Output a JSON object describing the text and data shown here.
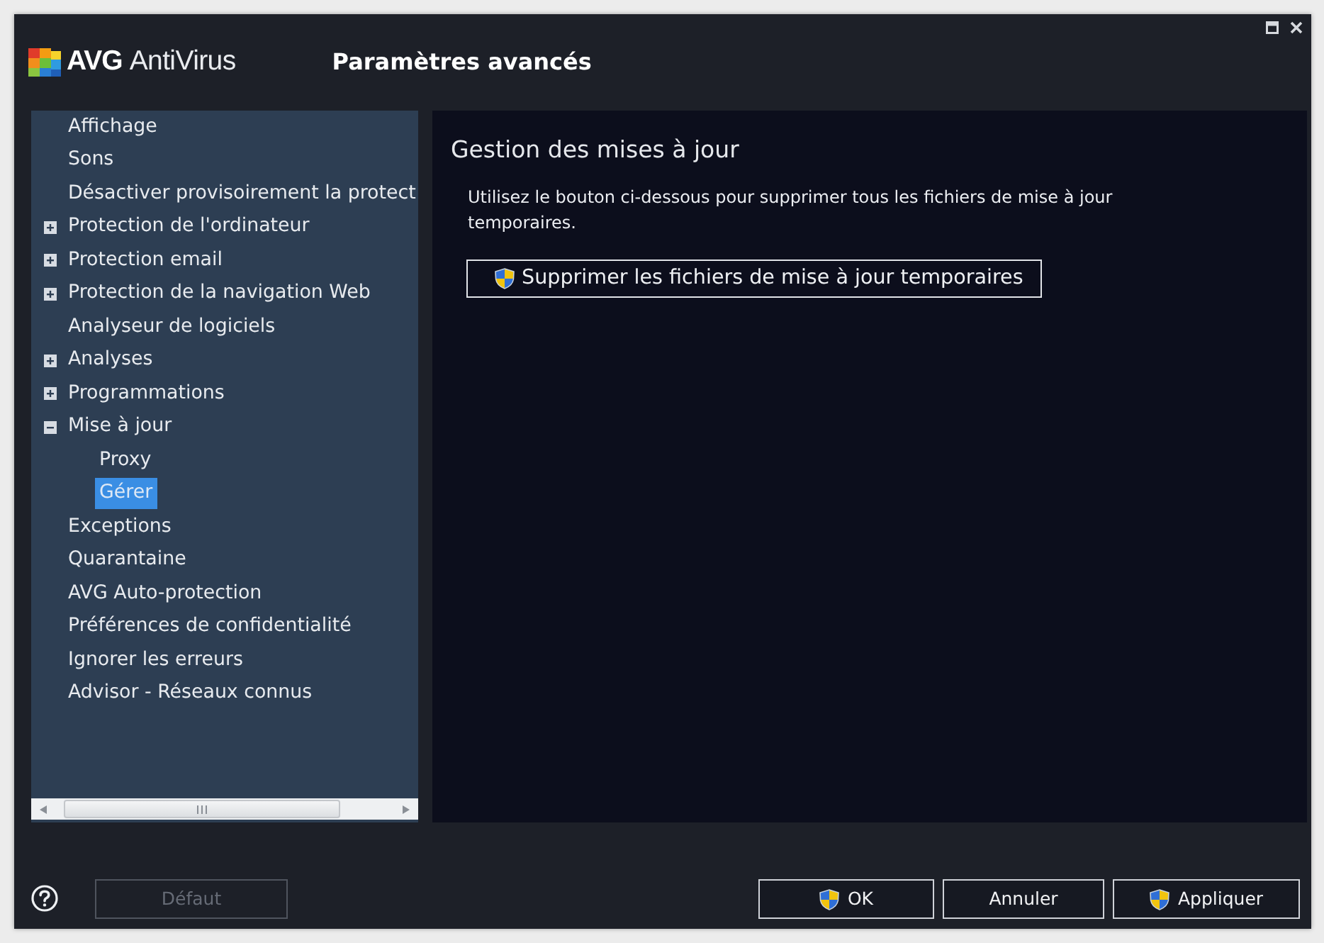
{
  "window": {
    "logo_text": "AVG",
    "product": "AntiVirus",
    "title": "Paramètres avancés"
  },
  "sidebar": {
    "items": [
      {
        "label": "Affichage",
        "kind": "leaf",
        "selected": false
      },
      {
        "label": "Sons",
        "kind": "leaf",
        "selected": false
      },
      {
        "label": "Désactiver provisoirement la protect",
        "kind": "leaf",
        "selected": false
      },
      {
        "label": "Protection de l'ordinateur",
        "kind": "group",
        "expanded": false,
        "selected": false
      },
      {
        "label": "Protection email",
        "kind": "group",
        "expanded": false,
        "selected": false
      },
      {
        "label": "Protection de la navigation Web",
        "kind": "group",
        "expanded": false,
        "selected": false
      },
      {
        "label": "Analyseur de logiciels",
        "kind": "leaf",
        "selected": false
      },
      {
        "label": "Analyses",
        "kind": "group",
        "expanded": false,
        "selected": false
      },
      {
        "label": "Programmations",
        "kind": "group",
        "expanded": false,
        "selected": false
      },
      {
        "label": "Mise à jour",
        "kind": "group",
        "expanded": true,
        "selected": false,
        "children": [
          {
            "label": "Proxy",
            "selected": false
          },
          {
            "label": "Gérer",
            "selected": true
          }
        ]
      },
      {
        "label": "Exceptions",
        "kind": "leaf",
        "selected": false
      },
      {
        "label": "Quarantaine",
        "kind": "leaf",
        "selected": false
      },
      {
        "label": "AVG Auto-protection",
        "kind": "leaf",
        "selected": false
      },
      {
        "label": "Préférences de confidentialité",
        "kind": "leaf",
        "selected": false
      },
      {
        "label": "Ignorer les erreurs",
        "kind": "leaf",
        "selected": false
      },
      {
        "label": "Advisor - Réseaux connus",
        "kind": "leaf",
        "selected": false
      }
    ]
  },
  "content": {
    "heading": "Gestion des mises à jour",
    "description": "Utilisez le bouton ci-dessous pour supprimer tous les fichiers de mise à jour temporaires.",
    "action_button": {
      "label": "Supprimer les fichiers de mise à jour temporaires",
      "shield": true
    }
  },
  "footer": {
    "default_button": {
      "label": "Défaut",
      "disabled": true
    },
    "buttons": [
      {
        "label": "OK",
        "shield": true,
        "disabled": false
      },
      {
        "label": "Annuler",
        "shield": false,
        "disabled": false
      },
      {
        "label": "Appliquer",
        "shield": true,
        "disabled": false
      }
    ]
  }
}
